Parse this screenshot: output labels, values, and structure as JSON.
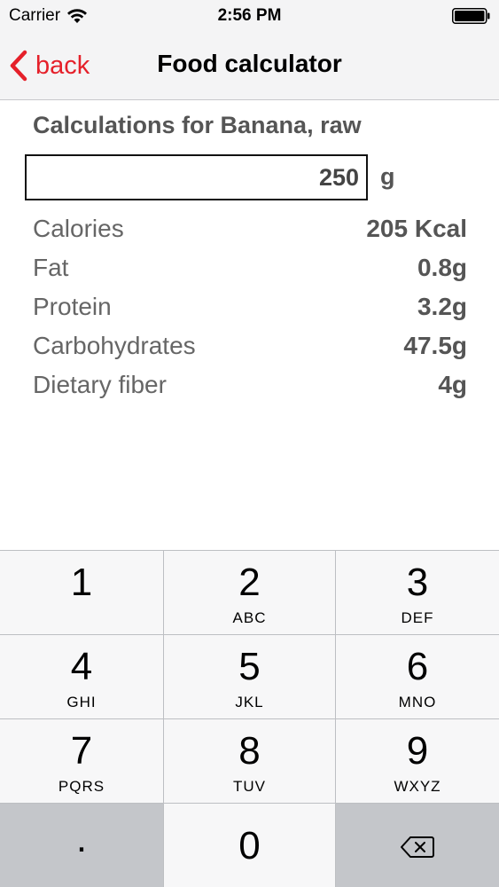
{
  "status_bar": {
    "carrier": "Carrier",
    "time": "2:56 PM",
    "wifi_icon": "wifi-icon",
    "battery_icon": "battery-icon"
  },
  "nav": {
    "back_label": "back",
    "title": "Food calculator",
    "accent_color": "#e5202a"
  },
  "calc": {
    "heading": "Calculations for Banana, raw",
    "amount_value": "250",
    "amount_unit": "g"
  },
  "nutrients": [
    {
      "name": "Calories",
      "value": "205 Kcal"
    },
    {
      "name": "Fat",
      "value": "0.8g"
    },
    {
      "name": "Protein",
      "value": "3.2g"
    },
    {
      "name": "Carbohydrates",
      "value": "47.5g"
    },
    {
      "name": "Dietary fiber",
      "value": "4g"
    }
  ],
  "keypad": {
    "keys": [
      {
        "digit": "1",
        "letters": ""
      },
      {
        "digit": "2",
        "letters": "ABC"
      },
      {
        "digit": "3",
        "letters": "DEF"
      },
      {
        "digit": "4",
        "letters": "GHI"
      },
      {
        "digit": "5",
        "letters": "JKL"
      },
      {
        "digit": "6",
        "letters": "MNO"
      },
      {
        "digit": "7",
        "letters": "PQRS"
      },
      {
        "digit": "8",
        "letters": "TUV"
      },
      {
        "digit": "9",
        "letters": "WXYZ"
      }
    ],
    "decimal": ".",
    "zero": "0",
    "delete_icon": "backspace-icon"
  }
}
